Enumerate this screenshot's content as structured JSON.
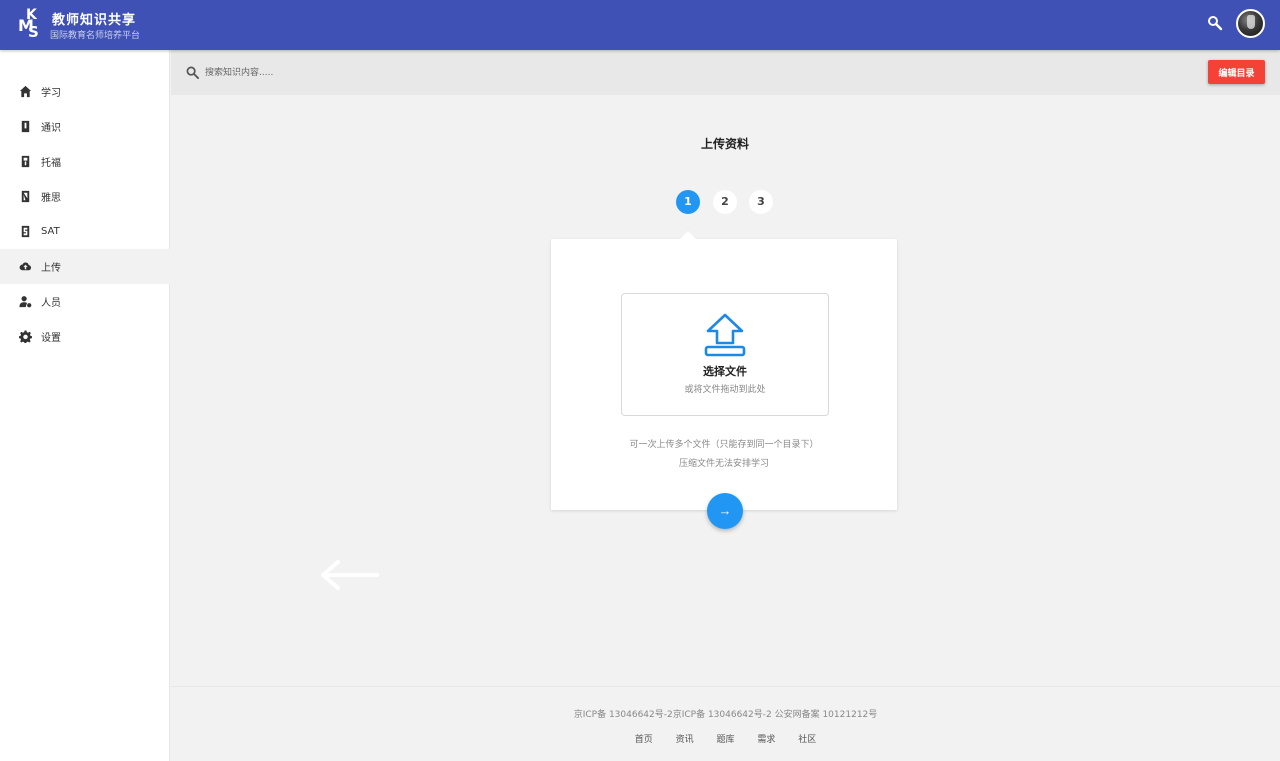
{
  "header": {
    "logo_letters": [
      "K",
      "M",
      "S"
    ],
    "title": "教师知识共享",
    "subtitle": "国际教育名师培养平台"
  },
  "sidebar": {
    "items": [
      {
        "label": "学习",
        "icon": "home-icon"
      },
      {
        "label": "通识",
        "icon": "book-icon"
      },
      {
        "label": "托福",
        "icon": "book-icon"
      },
      {
        "label": "雅思",
        "icon": "book-icon"
      },
      {
        "label": "SAT",
        "icon": "book-icon"
      },
      {
        "label": "上传",
        "icon": "cloud-upload-icon",
        "active": true
      },
      {
        "label": "人员",
        "icon": "user-settings-icon"
      },
      {
        "label": "设置",
        "icon": "gear-icon"
      }
    ]
  },
  "search": {
    "placeholder": "搜索知识内容....."
  },
  "toolbar": {
    "edit_label": "编辑目录"
  },
  "main": {
    "title": "上传资料",
    "steps": [
      "1",
      "2",
      "3"
    ],
    "current_step": 1,
    "dropzone_title": "选择文件",
    "dropzone_sub": "或将文件拖动到此处",
    "note1": "可一次上传多个文件（只能存到同一个目录下）",
    "note2": "压缩文件无法安排学习",
    "next_label": "→"
  },
  "footer": {
    "text": "京ICP备 13046642号-2京ICP备 13046642号-2 公安网备案  10121212号",
    "links": [
      "首页",
      "资讯",
      "题库",
      "需求",
      "社区"
    ]
  },
  "colors": {
    "header": "#3f51b5",
    "accent": "#2196f3",
    "danger": "#f44336"
  }
}
